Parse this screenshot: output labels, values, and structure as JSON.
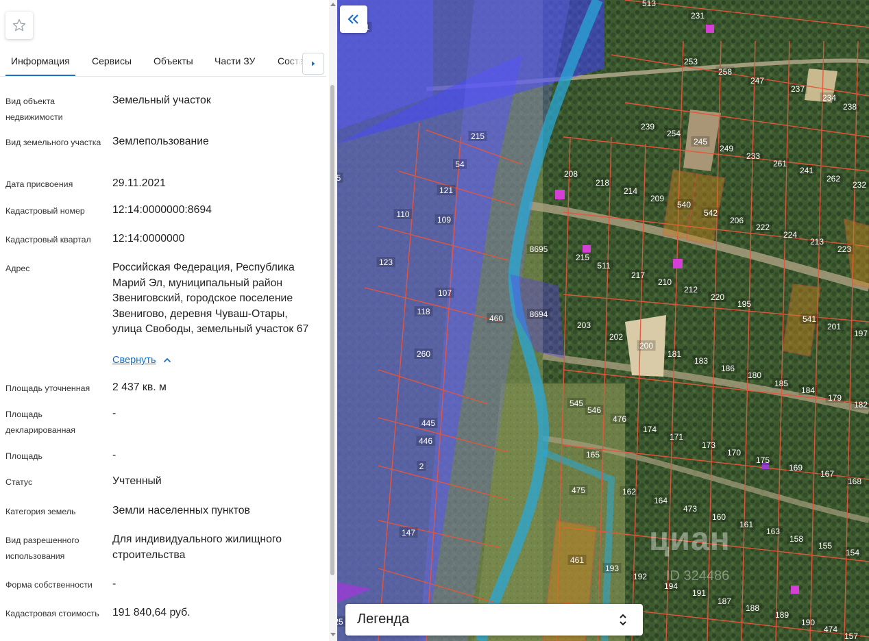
{
  "tabs": [
    "Информация",
    "Сервисы",
    "Объекты",
    "Части ЗУ",
    "Соста"
  ],
  "info": {
    "object_type_label": "Вид объекта недвижимости",
    "object_type_value": "Земельный участок",
    "land_type_label": "Вид земельного участка",
    "land_type_value": "Землепользование",
    "date_label": "Дата присвоения",
    "date_value": "29.11.2021",
    "cadastral_number_label": "Кадастровый номер",
    "cadastral_number_value": "12:14:0000000:8694",
    "quarter_label": "Кадастровый квартал",
    "quarter_value": "12:14:0000000",
    "address_label": "Адрес",
    "address_value": "Российская Федерация, Республика Марий Эл, муниципальный район Звениговский, городское поселение Звенигово, деревня Чуваш-Отары, улица Свободы, земельный участок 67",
    "collapse_link": "Свернуть",
    "area_refined_label": "Площадь уточненная",
    "area_refined_value": "2 437 кв. м",
    "area_declared_label": "Площадь декларированная",
    "area_declared_value": "-",
    "area_label": "Площадь",
    "area_value": "-",
    "status_label": "Статус",
    "status_value": "Учтенный",
    "category_label": "Категория земель",
    "category_value": "Земли населенных пунктов",
    "permitted_use_label": "Вид разрешенного использования",
    "permitted_use_value": "Для индивидуального жилищного строительства",
    "ownership_label": "Форма собственности",
    "ownership_value": "-",
    "cost_label": "Кадастровая стоимость",
    "cost_value": "191 840,64 руб."
  },
  "map": {
    "legend_title": "Легенда",
    "watermark": "циан",
    "watermark_id": "ID 324486",
    "selected_parcel": "8694",
    "parcel_labels": [
      "513",
      "231",
      "253",
      "258",
      "247",
      "237",
      "234",
      "238",
      "215",
      "54",
      "239",
      "254",
      "245",
      "249",
      "233",
      "261",
      "241",
      "262",
      "232",
      "121",
      "208",
      "218",
      "214",
      "209",
      "540",
      "542",
      "206",
      "222",
      "224",
      "213",
      "223",
      "110",
      "109",
      "123",
      "8695",
      "215",
      "511",
      "217",
      "210",
      "212",
      "220",
      "195",
      "107",
      "118",
      "460",
      "203",
      "202",
      "200",
      "181",
      "183",
      "186",
      "180",
      "185",
      "184",
      "179",
      "182",
      "541",
      "201",
      "197",
      "260",
      "545",
      "546",
      "476",
      "174",
      "171",
      "173",
      "170",
      "175",
      "169",
      "167",
      "168",
      "445",
      "446",
      "2",
      "165",
      "475",
      "162",
      "164",
      "473",
      "160",
      "161",
      "163",
      "158",
      "155",
      "154",
      "147",
      "461",
      "193",
      "192",
      "194",
      "191",
      "187",
      "188",
      "189",
      "190",
      "474",
      "157",
      "8694",
      "5",
      "25",
      "1"
    ]
  },
  "colors": {
    "accent": "#1c6fc7",
    "parcel_border": "#e8553a",
    "selected_parcel_border": "#5b3cff",
    "zone_overlay": "#3f3fff",
    "river_zone": "#2aa7d6"
  }
}
